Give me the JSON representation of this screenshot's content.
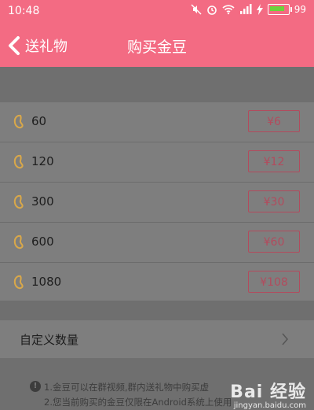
{
  "status_bar": {
    "time": "10:48",
    "battery": "99",
    "icons": [
      "mute-icon",
      "alarm-icon",
      "wifi-icon",
      "signal-icon",
      "charging-icon"
    ]
  },
  "nav": {
    "back_label": "送礼物",
    "title": "购买金豆"
  },
  "packages": [
    {
      "amount": "60",
      "price": "¥6"
    },
    {
      "amount": "120",
      "price": "¥12"
    },
    {
      "amount": "300",
      "price": "¥30"
    },
    {
      "amount": "600",
      "price": "¥60"
    },
    {
      "amount": "1080",
      "price": "¥108"
    }
  ],
  "custom": {
    "label": "自定义数量"
  },
  "notes": {
    "line1": "1.金豆可以在群视频,群内送礼物中购买虚",
    "line2": "2.您当前购买的金豆仅限在Android系统上使用"
  },
  "watermark": {
    "brand": "Bai 经验",
    "url": "jingyan.baidu.com"
  },
  "colors": {
    "accent": "#f36b83",
    "price_border": "#b24b5d",
    "bean": "#d9a84a"
  }
}
